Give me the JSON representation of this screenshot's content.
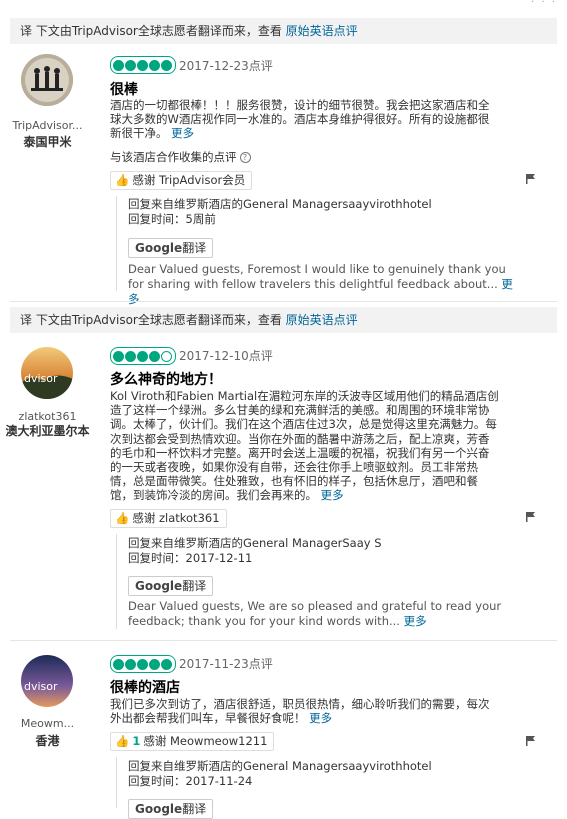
{
  "translate_bar": {
    "prefix": "译 下文由TripAdvisor全球志愿者翻译而来，查看 ",
    "link": "原始英语点评"
  },
  "reviews": [
    {
      "user": "TripAdvisor...",
      "location": "泰国甲米",
      "rating": 5,
      "date": "2017-12-23点评",
      "title": "很棒",
      "body": "酒店的一切都很棒！！！服务很赞，设计的细节很赞。我会把这家酒店和全球大多数的W酒店视作同一水准的。酒店本身维护得很好。所有的设施都很新很干净。",
      "more": "更多",
      "collected": "与该酒店合作收集的点评",
      "thanks_count": "",
      "thanks": "感谢 TripAdvisor会员",
      "response_from": "回复来自维罗斯酒店的General Managersaayvirothhotel",
      "response_time": "回复时间：5周前",
      "google_label": "Google",
      "translate_label": "翻译",
      "response_text": "Dear Valued guests, Foremost I would like to genuinely thank you for sharing with fellow travelers this delightful feedback about...",
      "response_more": "更多"
    },
    {
      "user": "zlatkot361",
      "location": "澳大利亚墨尔本",
      "rating": 4,
      "date": "2017-12-10点评",
      "title": "多么神奇的地方！",
      "body": "Kol Viroth和Fabien Martial在湄粒河东岸的沃波寺区域用他们的精品酒店创造了这样一个绿洲。多么甘美的绿和充满鲜活的美感。和周围的环境非常协调。太棒了，伙计们。我们在这个酒店住过3次，总是觉得这里充满魅力。每次到达都会受到热情欢迎。当你在外面的酷暑中游荡之后，配上凉爽，芳香的毛巾和一杯饮料才完整。离开时会送上温暖的祝福，祝我们有另一个兴奋的一天或者夜晚，如果你没有自带，还会往你手上喷驱蚊剂。员工非常热情，总是面带微笑。住处雅致，也有怀旧的样子，包括休息厅，酒吧和餐馆，到装饰冷淡的房间。我们会再来的。",
      "more": "更多",
      "thanks_count": "",
      "thanks": "感谢 zlatkot361",
      "response_from": "回复来自维罗斯酒店的General ManagerSaay S",
      "response_time": "回复时间：2017-12-11",
      "google_label": "Google",
      "translate_label": "翻译",
      "response_text": "Dear Valued guests, We are so pleased and grateful to read your feedback; thank you for your kind words with...",
      "response_more": "更多"
    },
    {
      "user": "Meowm...",
      "location": "香港",
      "rating": 5,
      "date": "2017-11-23点评",
      "title": "很棒的酒店",
      "body": "我们已多次到访了，酒店很舒适，职员很热情，细心聆听我们的需要，每次外出都会帮我们叫车，早餐很好食呢！",
      "more": "更多",
      "thanks_count": "1",
      "thanks": "感谢 Meowmeow1211",
      "response_from": "回复来自维罗斯酒店的General Managersaayvirothhotel",
      "response_time": "回复时间：2017-11-24",
      "google_label": "Google",
      "translate_label": "翻译"
    }
  ],
  "colors": {
    "accent": "#00a680",
    "link": "#006699"
  },
  "icons": [
    "help-icon",
    "thumbs-up-icon",
    "flag-icon",
    "rating-bubble-icon"
  ]
}
